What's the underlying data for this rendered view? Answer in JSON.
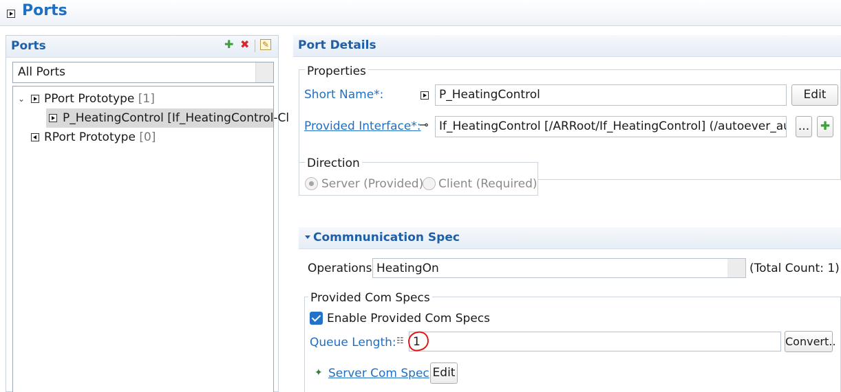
{
  "editor": {
    "title": "Ports"
  },
  "ports": {
    "header": "Ports",
    "toolbar": {
      "add_icon": "plus-icon",
      "delete_icon": "delete-x-icon",
      "edit_icon": "edit-pencil-icon"
    },
    "filter_value": "All Ports",
    "tree": [
      {
        "label": "PPort Prototype",
        "count": "[1]",
        "children": [
          {
            "label": "P_HeatingControl [If_HeatingControl-Cl"
          }
        ]
      },
      {
        "label": "RPort Prototype",
        "count": "[0]"
      }
    ]
  },
  "details": {
    "header": "Port Details",
    "properties": {
      "group_label": "Properties",
      "short_name_label": "Short Name*:",
      "short_name_value": "P_HeatingControl",
      "edit_label": "Edit",
      "provided_interface_label": "Provided Interface*:",
      "provided_interface_value": "If_HeatingControl [/ARRoot/If_HeatingControl] (/autoever_auto",
      "browse_label": "..."
    },
    "direction": {
      "group_label": "Direction",
      "server_label": "Server (Provided)",
      "client_label": "Client (Required)",
      "selected": "Server (Provided)"
    },
    "com_spec": {
      "header": "Commnunication Spec",
      "operations_label": "Operations",
      "operations_value": "HeatingOn",
      "total_count": "(Total Count: 1)",
      "provided_group_label": "Provided Com Specs",
      "enable_label": "Enable Provided Com Specs",
      "enable_checked": true,
      "queue_length_label": "Queue Length:",
      "queue_length_value": "1",
      "convert_label": "Convert..",
      "server_com_spec_label": "Server Com Spec",
      "server_edit_label": "Edit"
    }
  }
}
